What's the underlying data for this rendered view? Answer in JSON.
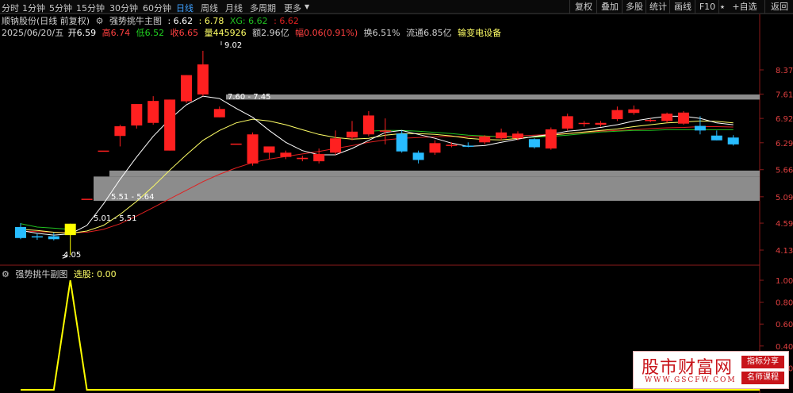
{
  "toolbar": {
    "timeframes": [
      "分时",
      "1分钟",
      "5分钟",
      "15分钟",
      "30分钟",
      "60分钟",
      "日线",
      "周线",
      "月线",
      "多周期",
      "更多"
    ],
    "active": "日线",
    "right_buttons": [
      "复权",
      "叠加",
      "多股",
      "统计",
      "画线",
      "F10",
      "+自选",
      "返回"
    ]
  },
  "header": {
    "title": "顺钠股份(日线 前复权)",
    "indicator_name": "强势挑牛主图",
    "ind_v1": ": 6.62",
    "ind_v2": ": 6.78",
    "ind_xg": "XG: 6.62",
    "ind_v3": ": 6.62"
  },
  "ohlc": {
    "date": "2025/06/20/五",
    "open": "开6.59",
    "high": "高6.74",
    "low": "低6.52",
    "close": "收6.65",
    "volume": "量445926",
    "amount": "额2.96亿",
    "change": "幅0.06(0.91%)",
    "turnover": "换6.51%",
    "float": "流通6.85亿",
    "sector": "输变电设备"
  },
  "price_axis": [
    "8.37",
    "7.61",
    "6.92",
    "6.29",
    "5.66",
    "5.09",
    "4.59",
    "4.13"
  ],
  "sub_axis": [
    "1.00",
    "0.80",
    "0.60",
    "0.40",
    "0.20"
  ],
  "annotations": {
    "high": "9.02",
    "low": "4.05",
    "zone_top": "7.60 - 7.45",
    "zone_mid": "5.51 - 5.64",
    "zone_bot": "5.01 - 5.51"
  },
  "subchart": {
    "title": "强势挑牛副图",
    "select_label": "选股: 0.00"
  },
  "watermark": {
    "title": "股市财富网",
    "url": "WWW.GSCFW.COM",
    "tag1": "指标分享",
    "tag2": "名师课程"
  },
  "candles": [
    {
      "o": 4.52,
      "h": 4.59,
      "l": 4.31,
      "c": 4.33
    },
    {
      "o": 4.36,
      "h": 4.41,
      "l": 4.3,
      "c": 4.34
    },
    {
      "o": 4.36,
      "h": 4.42,
      "l": 4.29,
      "c": 4.31
    },
    {
      "o": 4.38,
      "h": 4.58,
      "l": 4.05,
      "c": 4.58
    },
    {
      "o": 5.05,
      "h": 5.05,
      "l": 5.05,
      "c": 5.05
    },
    {
      "o": 6.1,
      "h": 6.1,
      "l": 6.1,
      "c": 6.1
    },
    {
      "o": 6.46,
      "h": 6.75,
      "l": 6.2,
      "c": 6.71
    },
    {
      "o": 6.73,
      "h": 7.32,
      "l": 6.65,
      "c": 7.32
    },
    {
      "o": 6.8,
      "h": 7.55,
      "l": 6.75,
      "c": 7.41
    },
    {
      "o": 6.1,
      "h": 7.45,
      "l": 6.1,
      "c": 7.45
    },
    {
      "o": 7.4,
      "h": 8.2,
      "l": 7.35,
      "c": 8.2
    },
    {
      "o": 7.6,
      "h": 9.02,
      "l": 7.55,
      "c": 8.55
    },
    {
      "o": 6.95,
      "h": 7.25,
      "l": 6.95,
      "c": 7.18
    },
    {
      "o": 6.27,
      "h": 6.27,
      "l": 6.27,
      "c": 6.27
    },
    {
      "o": 5.8,
      "h": 6.55,
      "l": 5.75,
      "c": 6.5
    },
    {
      "o": 6.05,
      "h": 6.1,
      "l": 5.9,
      "c": 6.2
    },
    {
      "o": 5.95,
      "h": 6.1,
      "l": 5.9,
      "c": 6.05
    },
    {
      "o": 5.9,
      "h": 5.98,
      "l": 5.85,
      "c": 5.93
    },
    {
      "o": 5.85,
      "h": 6.15,
      "l": 5.8,
      "c": 6.02
    },
    {
      "o": 6.05,
      "h": 6.6,
      "l": 6.0,
      "c": 6.4
    },
    {
      "o": 6.42,
      "h": 6.85,
      "l": 6.35,
      "c": 6.57
    },
    {
      "o": 6.5,
      "h": 7.12,
      "l": 6.45,
      "c": 7.0
    },
    {
      "o": 6.6,
      "h": 6.92,
      "l": 6.25,
      "c": 6.6
    },
    {
      "o": 6.52,
      "h": 6.6,
      "l": 6.05,
      "c": 6.08
    },
    {
      "o": 6.05,
      "h": 6.1,
      "l": 5.8,
      "c": 5.88
    },
    {
      "o": 6.05,
      "h": 6.35,
      "l": 6.0,
      "c": 6.28
    },
    {
      "o": 6.22,
      "h": 6.3,
      "l": 6.18,
      "c": 6.24
    },
    {
      "o": 6.22,
      "h": 6.3,
      "l": 6.18,
      "c": 6.2
    },
    {
      "o": 6.3,
      "h": 6.48,
      "l": 6.25,
      "c": 6.45
    },
    {
      "o": 6.4,
      "h": 6.65,
      "l": 6.35,
      "c": 6.55
    },
    {
      "o": 6.4,
      "h": 6.58,
      "l": 6.35,
      "c": 6.52
    },
    {
      "o": 6.38,
      "h": 6.4,
      "l": 6.15,
      "c": 6.18
    },
    {
      "o": 6.15,
      "h": 6.68,
      "l": 6.12,
      "c": 6.63
    },
    {
      "o": 6.65,
      "h": 7.05,
      "l": 6.6,
      "c": 6.98
    },
    {
      "o": 6.78,
      "h": 6.85,
      "l": 6.7,
      "c": 6.8
    },
    {
      "o": 6.75,
      "h": 6.85,
      "l": 6.7,
      "c": 6.8
    },
    {
      "o": 6.9,
      "h": 7.25,
      "l": 6.85,
      "c": 7.15
    },
    {
      "o": 7.07,
      "h": 7.28,
      "l": 7.02,
      "c": 7.17
    },
    {
      "o": 6.85,
      "h": 6.92,
      "l": 6.82,
      "c": 6.88
    },
    {
      "o": 6.85,
      "h": 7.08,
      "l": 6.8,
      "c": 7.05
    },
    {
      "o": 6.78,
      "h": 7.12,
      "l": 6.75,
      "c": 7.08
    },
    {
      "o": 6.72,
      "h": 6.98,
      "l": 6.5,
      "c": 6.6
    },
    {
      "o": 6.47,
      "h": 6.6,
      "l": 6.35,
      "c": 6.35
    },
    {
      "o": 6.42,
      "h": 6.48,
      "l": 6.22,
      "c": 6.25
    }
  ],
  "ma_short": [
    4.46,
    4.41,
    4.38,
    4.4,
    4.55,
    4.95,
    5.45,
    5.95,
    6.45,
    6.9,
    7.3,
    7.55,
    7.48,
    7.2,
    6.95,
    6.6,
    6.3,
    6.1,
    6.0,
    6.0,
    6.15,
    6.35,
    6.55,
    6.6,
    6.5,
    6.4,
    6.28,
    6.2,
    6.22,
    6.3,
    6.38,
    6.45,
    6.5,
    6.58,
    6.62,
    6.68,
    6.75,
    6.85,
    6.92,
    6.98,
    6.98,
    6.92,
    6.8,
    6.75
  ],
  "ma_mid": [
    4.48,
    4.46,
    4.43,
    4.41,
    4.45,
    4.55,
    4.75,
    5.0,
    5.3,
    5.65,
    6.0,
    6.35,
    6.6,
    6.8,
    6.9,
    6.85,
    6.75,
    6.62,
    6.5,
    6.42,
    6.38,
    6.4,
    6.48,
    6.52,
    6.52,
    6.5,
    6.46,
    6.4,
    6.37,
    6.36,
    6.4,
    6.44,
    6.48,
    6.52,
    6.56,
    6.6,
    6.64,
    6.7,
    6.75,
    6.8,
    6.82,
    6.85,
    6.84,
    6.8
  ],
  "ma_long": [
    4.45,
    4.44,
    4.43,
    4.42,
    4.43,
    4.48,
    4.58,
    4.72,
    4.88,
    5.05,
    5.22,
    5.4,
    5.56,
    5.7,
    5.82,
    5.9,
    5.96,
    6.02,
    6.08,
    6.15,
    6.22,
    6.3,
    6.36,
    6.4,
    6.42,
    6.44,
    6.45,
    6.44,
    6.44,
    6.45,
    6.46,
    6.48,
    6.5,
    6.52,
    6.55,
    6.58,
    6.6,
    6.62,
    6.65,
    6.67,
    6.68,
    6.7,
    6.7,
    6.69
  ],
  "ma_green": [
    4.58,
    4.52,
    4.5,
    4.48,
    null,
    null,
    null,
    null,
    null,
    null,
    null,
    null,
    null,
    null,
    null,
    null,
    null,
    null,
    null,
    null,
    null,
    6.58,
    6.6,
    6.6,
    6.58,
    6.55,
    6.52,
    6.48,
    6.46,
    6.44,
    6.42,
    6.43,
    6.45,
    6.48,
    6.52,
    6.56,
    6.58,
    6.6,
    6.6,
    6.62,
    6.62,
    6.62,
    6.62,
    6.62
  ],
  "signal": [
    0,
    0,
    0,
    1,
    0,
    0,
    0,
    0,
    0,
    0,
    0,
    0,
    0,
    0,
    0,
    0,
    0,
    0,
    0,
    0,
    0,
    0,
    0,
    0,
    0,
    0,
    0,
    0,
    0,
    0,
    0,
    0,
    0,
    0,
    0,
    0,
    0,
    0,
    0,
    0,
    0,
    0,
    0,
    0
  ],
  "colors": {
    "up": "#ff2020",
    "down": "#28bcff",
    "hl": "#ffff00",
    "ma_short": "#ffffff",
    "ma_mid": "#ffff66",
    "ma_long": "#e02020",
    "ma_green": "#20c020",
    "zone": "#8c8c8c"
  }
}
